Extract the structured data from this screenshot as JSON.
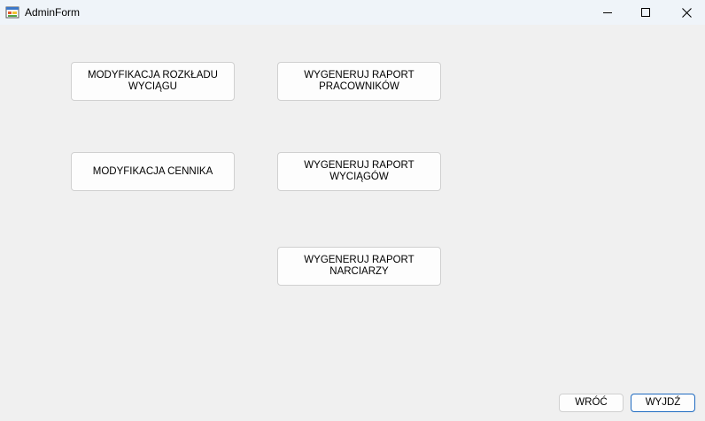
{
  "window": {
    "title": "AdminForm"
  },
  "main": {
    "buttons": {
      "modify_schedule": "MODYFIKACJA ROZKŁADU\nWYCIĄGU",
      "generate_employees_report": "WYGENERUJ RAPORT\nPRACOWNIKÓW",
      "modify_pricelist": "MODYFIKACJA CENNIKA",
      "generate_lifts_report": "WYGENERUJ RAPORT\nWYCIĄGÓW",
      "generate_skiers_report": "WYGENERUJ RAPORT\nNARCIARZY"
    }
  },
  "footer": {
    "back_label": "WRÓĆ",
    "exit_label": "WYJDŹ"
  },
  "icons": {
    "app": "windows-form-icon",
    "minimize": "minimize-icon",
    "maximize": "maximize-icon",
    "close": "close-icon"
  },
  "colors": {
    "window_bg": "#f0f0f0",
    "titlebar_bg": "#eff4f9",
    "button_bg": "#fdfdfd",
    "button_border": "#d0d0d0",
    "default_button_border": "#1f6bc1"
  }
}
